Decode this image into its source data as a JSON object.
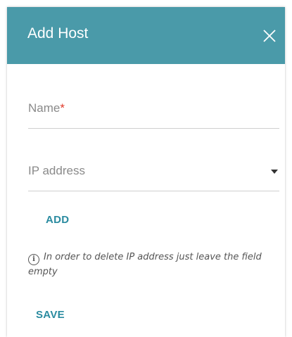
{
  "dialog": {
    "title": "Add Host",
    "close_icon": "close-icon"
  },
  "form": {
    "name_label": "Name",
    "name_required_mark": "*",
    "ip_label": "IP address",
    "add_label": "ADD",
    "info_icon": "info-icon",
    "info_text": "In order to delete IP address just leave the field empty",
    "save_label": "SAVE"
  },
  "colors": {
    "header_bg": "#4a9aa9",
    "accent": "#2a8ba0",
    "required": "#e03a2a"
  }
}
